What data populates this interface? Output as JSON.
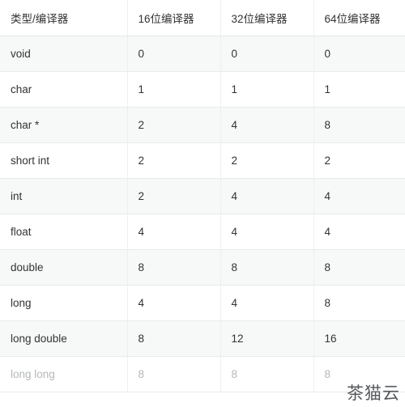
{
  "watermark": {
    "text": "茶猫云"
  },
  "table": {
    "headers": [
      "类型/编译器",
      "16位编译器",
      "32位编译器",
      "64位编译器"
    ],
    "rows": [
      {
        "type": "void",
        "c16": "0",
        "c32": "0",
        "c64": "0",
        "faded": false
      },
      {
        "type": "char",
        "c16": "1",
        "c32": "1",
        "c64": "1",
        "faded": false
      },
      {
        "type": "char *",
        "c16": "2",
        "c32": "4",
        "c64": "8",
        "faded": false
      },
      {
        "type": "short int",
        "c16": "2",
        "c32": "2",
        "c64": "2",
        "faded": false
      },
      {
        "type": "int",
        "c16": "2",
        "c32": "4",
        "c64": "4",
        "faded": false
      },
      {
        "type": "float",
        "c16": "4",
        "c32": "4",
        "c64": "4",
        "faded": false
      },
      {
        "type": "double",
        "c16": "8",
        "c32": "8",
        "c64": "8",
        "faded": false
      },
      {
        "type": "long",
        "c16": "4",
        "c32": "4",
        "c64": "8",
        "faded": false
      },
      {
        "type": "long double",
        "c16": "8",
        "c32": "12",
        "c64": "16",
        "faded": false
      },
      {
        "type": "long long",
        "c16": "8",
        "c32": "8",
        "c64": "8",
        "faded": true
      }
    ]
  },
  "colors": {
    "shaded_row": "#f7f8f8",
    "plain_row": "#ffffff",
    "border": "#e8eaec",
    "text": "#333333",
    "faded_text": "#b4b8bb",
    "watermark": "#55585c"
  }
}
